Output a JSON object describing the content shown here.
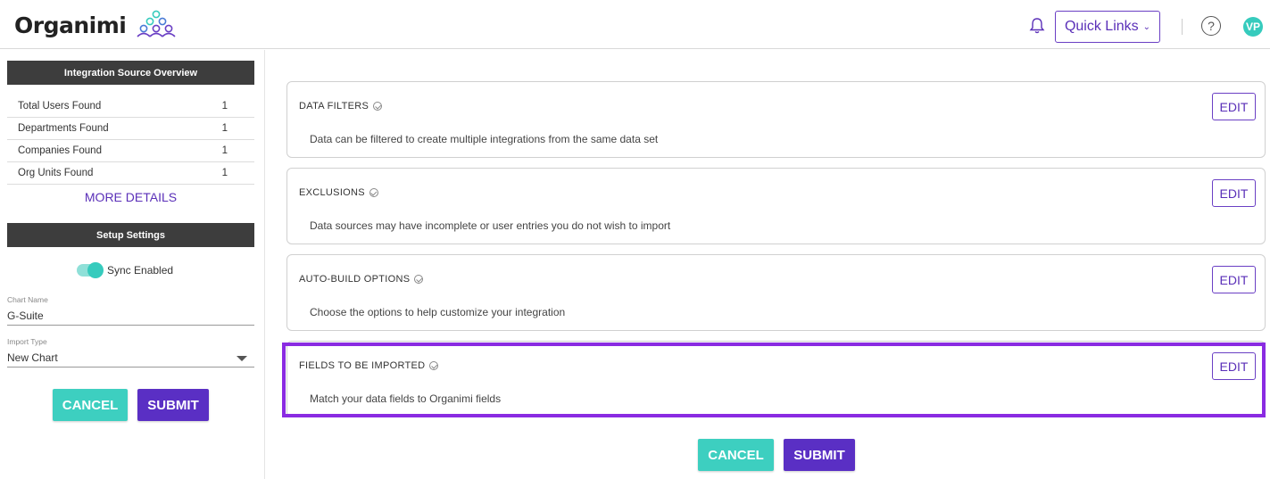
{
  "header": {
    "logo_text": "Organimi",
    "quick_links_label": "Quick Links",
    "help_label": "?",
    "avatar_initials": "VP"
  },
  "overview": {
    "title": "Integration Source Overview",
    "rows": [
      {
        "label": "Total Users Found",
        "value": "1"
      },
      {
        "label": "Departments Found",
        "value": "1"
      },
      {
        "label": "Companies Found",
        "value": "1"
      },
      {
        "label": "Org Units Found",
        "value": "1"
      }
    ],
    "more_details_label": "MORE DETAILS"
  },
  "setup": {
    "title": "Setup Settings",
    "sync_label": "Sync Enabled",
    "sync_enabled": true,
    "chart_name_label": "Chart Name",
    "chart_name_value": "G-Suite",
    "import_type_label": "Import Type",
    "import_type_value": "New Chart",
    "cancel_label": "CANCEL",
    "submit_label": "SUBMIT"
  },
  "cards": [
    {
      "title": "DATA FILTERS",
      "description": "Data can be filtered to create multiple integrations from the same data set",
      "edit_label": "EDIT"
    },
    {
      "title": "EXCLUSIONS",
      "description": "Data sources may have incomplete or user entries you do not wish to import",
      "edit_label": "EDIT"
    },
    {
      "title": "AUTO-BUILD OPTIONS",
      "description": "Choose the options to help customize your integration",
      "edit_label": "EDIT"
    },
    {
      "title": "FIELDS TO BE IMPORTED",
      "description": "Match your data fields to Organimi fields",
      "edit_label": "EDIT"
    }
  ],
  "footer": {
    "cancel_label": "CANCEL",
    "submit_label": "SUBMIT"
  },
  "colors": {
    "accent": "#5a2fc4",
    "teal": "#3dcfc0",
    "highlight": "#8a2be2",
    "dark_bar": "#3d3d3d"
  }
}
